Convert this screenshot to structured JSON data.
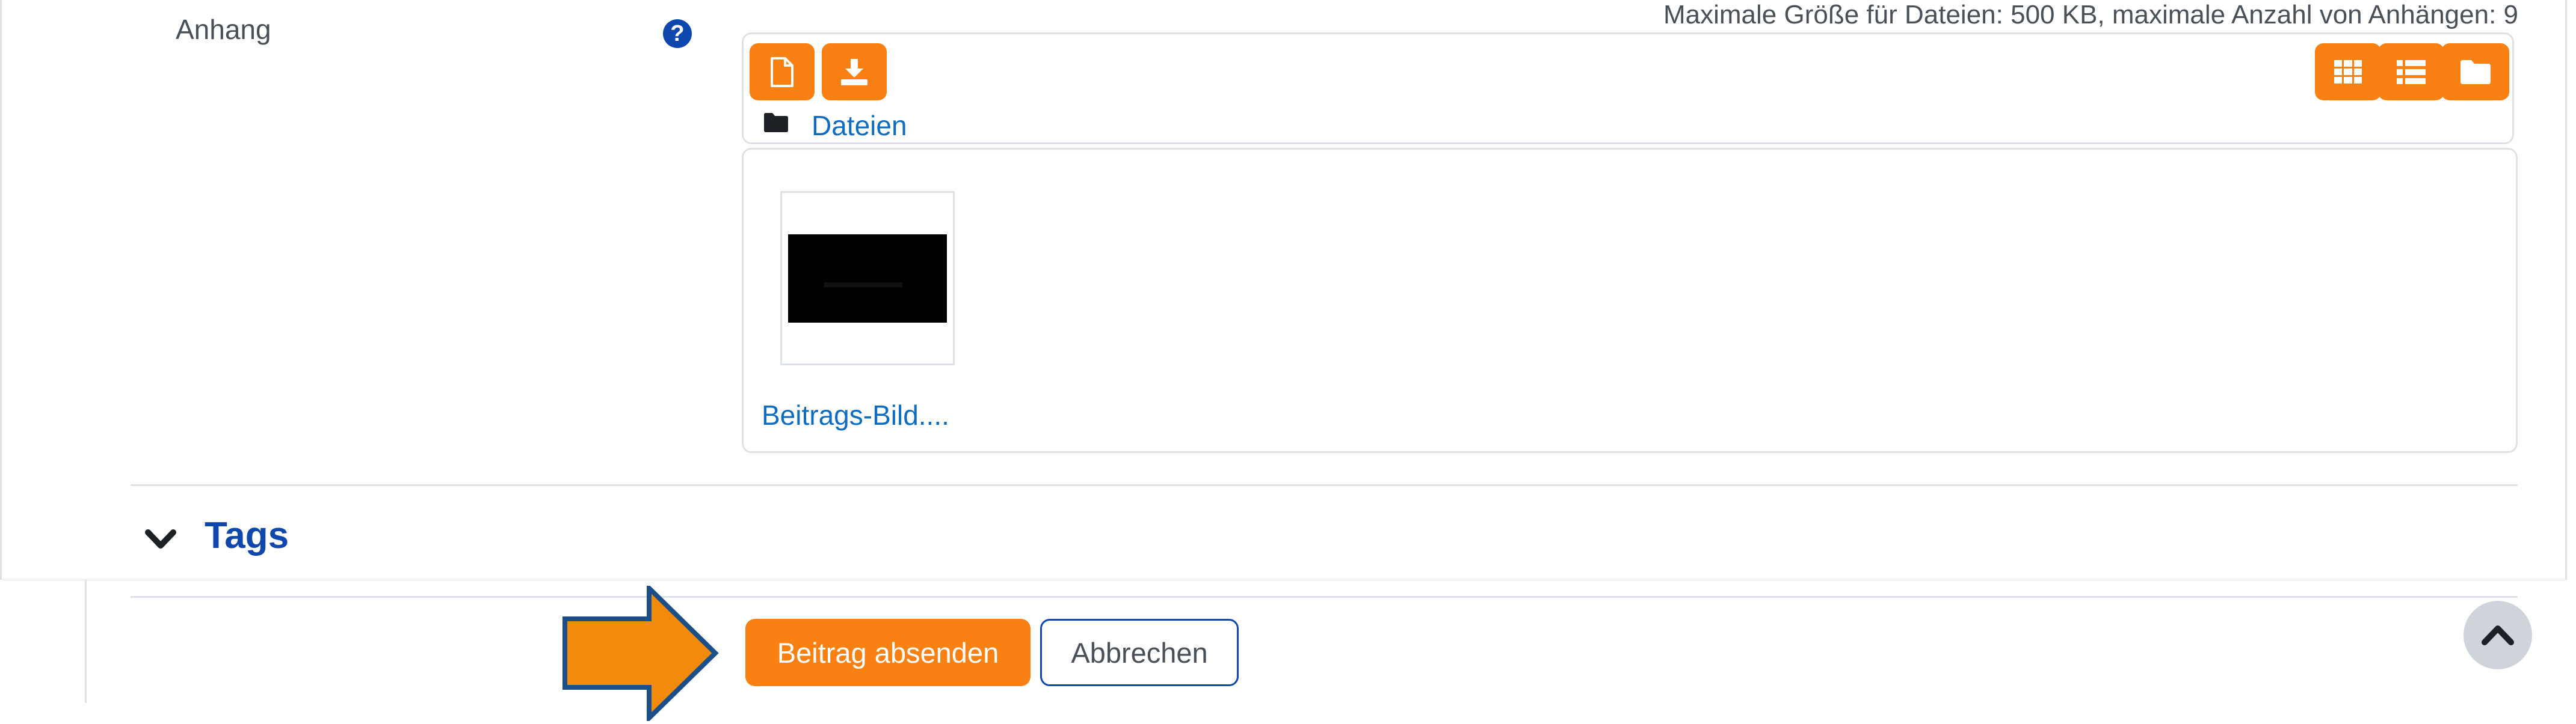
{
  "attachment": {
    "label": "Anhang",
    "help_icon": "question-circle-icon",
    "help_glyph": "?",
    "limits_text": "Maximale Größe für Dateien: 500 KB, maximale Anzahl von Anhängen: 9"
  },
  "filepicker": {
    "toolbar_left": [
      {
        "icon": "add-file-icon"
      },
      {
        "icon": "download-icon"
      }
    ],
    "view_buttons": [
      {
        "icon": "grid-view-icon"
      },
      {
        "icon": "list-view-icon"
      },
      {
        "icon": "folder-view-icon"
      }
    ],
    "path": {
      "icon": "folder-icon",
      "label": "Dateien"
    },
    "files": [
      {
        "name": "Beitrags-Bild....",
        "thumbnail": "black-image-thumbnail"
      }
    ]
  },
  "tags": {
    "title": "Tags",
    "icon": "chevron-down-icon"
  },
  "actions": {
    "submit_label": "Beitrag absenden",
    "cancel_label": "Abbrechen",
    "callout_icon": "arrow-right-icon",
    "back_to_top_icon": "chevron-up-icon"
  },
  "colors": {
    "accent": "#f98012",
    "link": "#0f6cbf",
    "heading": "#0f47ad",
    "border": "#dee2e6",
    "callout_fill": "#f28a0c",
    "callout_stroke": "#1b4f8a"
  }
}
